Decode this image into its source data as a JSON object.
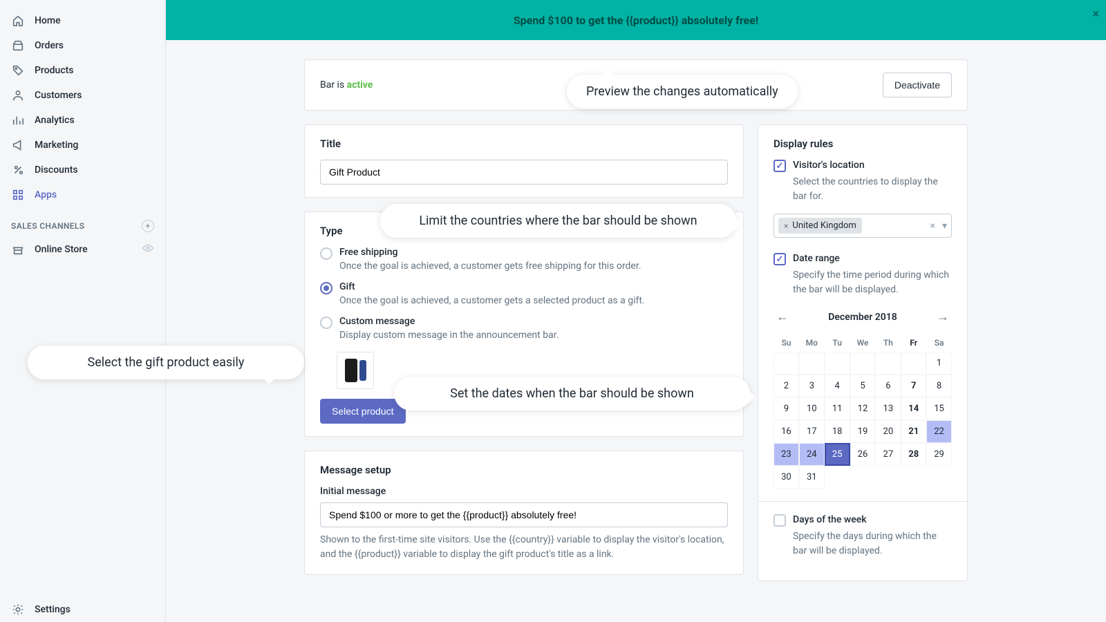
{
  "sidebar": {
    "items": [
      {
        "label": "Home"
      },
      {
        "label": "Orders"
      },
      {
        "label": "Products"
      },
      {
        "label": "Customers"
      },
      {
        "label": "Analytics"
      },
      {
        "label": "Marketing"
      },
      {
        "label": "Discounts"
      },
      {
        "label": "Apps"
      }
    ],
    "channels_heading": "SALES CHANNELS",
    "channel_item": "Online Store",
    "settings": "Settings"
  },
  "promo_bar": {
    "text": "Spend $100 to get the {{product}} absolutely free!"
  },
  "status": {
    "prefix": "Bar is ",
    "state": "active",
    "deactivate": "Deactivate"
  },
  "title_card": {
    "heading": "Title",
    "value": "Gift Product"
  },
  "type_card": {
    "heading": "Type",
    "options": [
      {
        "label": "Free shipping",
        "desc": "Once the goal is achieved, a customer gets free shipping for this order."
      },
      {
        "label": "Gift",
        "desc": "Once the goal is achieved, a customer gets a selected product as a gift."
      },
      {
        "label": "Custom message",
        "desc": "Display custom message in the announcement bar."
      }
    ],
    "select_product": "Select product"
  },
  "message_card": {
    "heading": "Message setup",
    "label": "Initial message",
    "value": "Spend $100 or more to get the {{product}} absolutely free!",
    "help": "Shown to the first-time site visitors. Use the {{country}} variable to display the visitor's location, and the {{product}} variable to display the gift product's title as a link."
  },
  "rules": {
    "heading": "Display rules",
    "location_label": "Visitor's location",
    "location_desc": "Select the countries to display the bar for.",
    "country": "United Kingdom",
    "date_label": "Date range",
    "date_desc": "Specify the time period during which the bar will be displayed.",
    "cal_title": "December 2018",
    "day_headers": [
      "Su",
      "Mo",
      "Tu",
      "We",
      "Th",
      "Fr",
      "Sa"
    ],
    "days_label": "Days of the week",
    "days_desc": "Specify the days during which the bar will be displayed."
  },
  "callouts": {
    "c1": "Preview the changes automatically",
    "c2": "Limit the countries where the bar should be shown",
    "c3": "Select the gift product easily",
    "c4": "Set the dates when the bar should be shown"
  }
}
